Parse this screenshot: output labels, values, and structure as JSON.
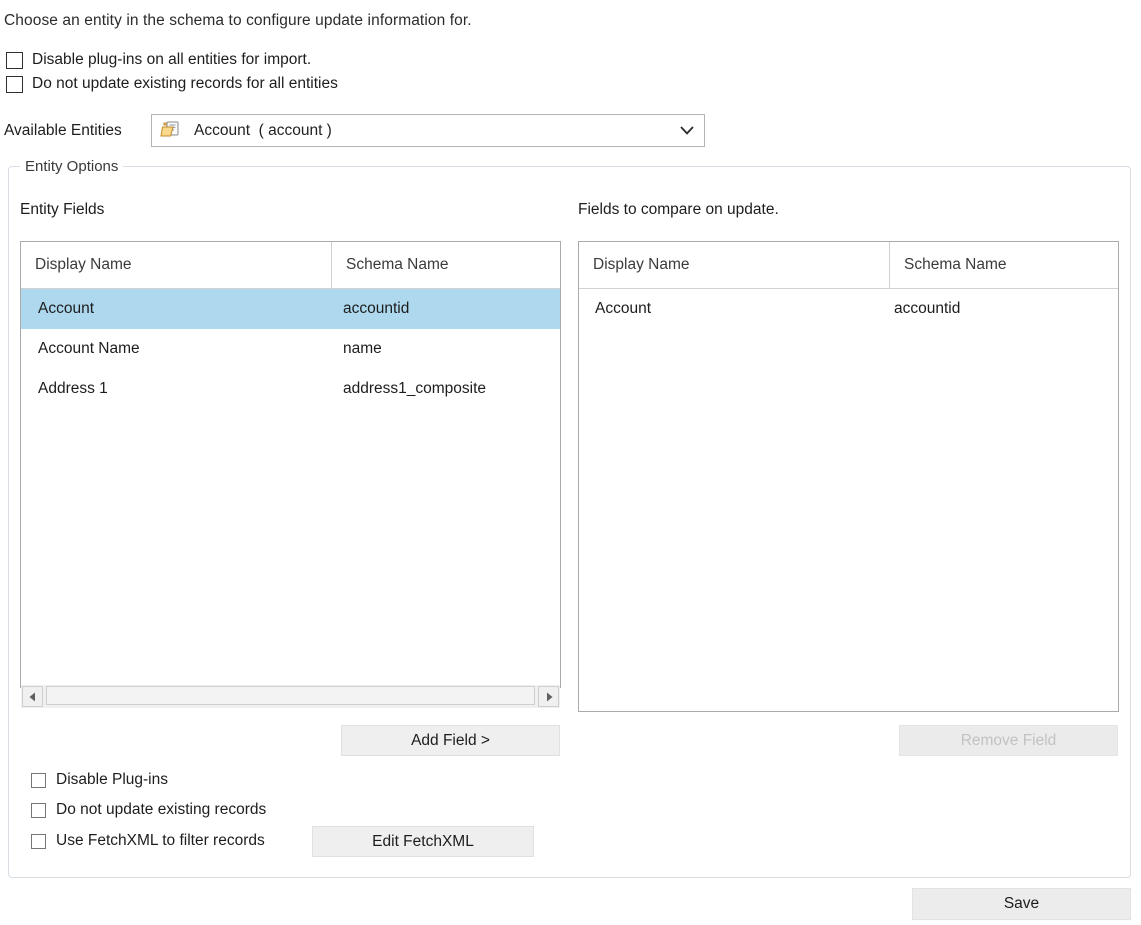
{
  "intro": "Choose an entity in the schema to configure update information for.",
  "global_options": [
    {
      "label": "Disable plug-ins on all entities for import.",
      "checked": false
    },
    {
      "label": "Do not update existing records for all entities",
      "checked": false
    }
  ],
  "available_entities": {
    "label": "Available Entities",
    "icon": "folder-document-icon",
    "selected": "Account  ( account )",
    "arrow_icon": "chevron-down-icon"
  },
  "entity_options": {
    "legend": "Entity Options",
    "left_panel": {
      "caption": "Entity Fields",
      "columns": [
        "Display Name",
        "Schema Name"
      ],
      "rows": [
        {
          "display_name": "Account",
          "schema_name": "accountid",
          "selected": true
        },
        {
          "display_name": "Account Name",
          "schema_name": "name",
          "selected": false
        },
        {
          "display_name": "Address 1",
          "schema_name": "address1_composite",
          "selected": false
        }
      ],
      "scrollbar": {
        "left_arrow_icon": "arrow-left-icon",
        "right_arrow_icon": "arrow-right-icon"
      },
      "add_button": "Add Field >"
    },
    "right_panel": {
      "caption": "Fields to compare on update.",
      "columns": [
        "Display Name",
        "Schema Name"
      ],
      "rows": [
        {
          "display_name": "Account",
          "schema_name": "accountid"
        }
      ],
      "remove_button": "Remove Field",
      "remove_button_disabled": true
    },
    "entity_checkboxes": [
      {
        "label": "Disable Plug-ins",
        "checked": false
      },
      {
        "label": "Do not update existing records",
        "checked": false
      },
      {
        "label": "Use FetchXML to filter records",
        "checked": false
      }
    ],
    "edit_fetchxml_button": "Edit FetchXML"
  },
  "save_button": "Save",
  "colors": {
    "selection": "#ADD8EE",
    "groupbox_border": "#d7dde3",
    "list_border": "#aaaaaa",
    "button_face": "#efefef",
    "disabled_text": "#c2c2c2"
  }
}
